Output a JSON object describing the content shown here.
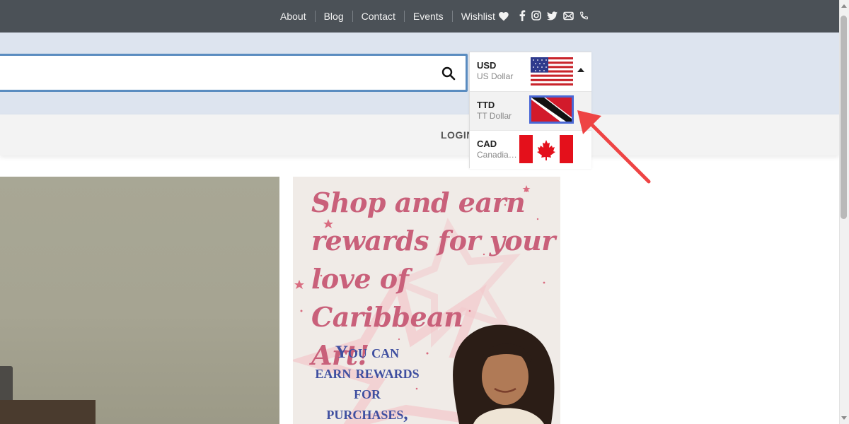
{
  "topnav": {
    "items": [
      {
        "label": "About"
      },
      {
        "label": "Blog"
      },
      {
        "label": "Contact"
      },
      {
        "label": "Events"
      },
      {
        "label": "Wishlist"
      }
    ]
  },
  "social_icons": [
    "facebook-icon",
    "instagram-icon",
    "twitter-icon",
    "email-icon",
    "phone-icon"
  ],
  "search": {
    "placeholder": "",
    "value": ""
  },
  "header": {
    "login_label": "LOGIN"
  },
  "currency": {
    "options": [
      {
        "code": "USD",
        "name": "US Dollar",
        "flag": "us-flag-icon",
        "selected": true
      },
      {
        "code": "TTD",
        "name": "TT Dollar",
        "flag": "tt-flag-icon",
        "highlighted": true
      },
      {
        "code": "CAD",
        "name": "Canadian Dollar",
        "flag": "ca-flag-icon"
      }
    ]
  },
  "promo": {
    "headline_lines": [
      "Shop and earn",
      "rewards for your",
      "love of Caribbean",
      "Art!"
    ],
    "sub_lines": [
      "You can",
      "earn rewards",
      "for",
      "purchases,"
    ]
  },
  "colors": {
    "topbar": "#4b5157",
    "search_band": "#dde4ef",
    "search_border": "#5a8cc0",
    "highlight_border": "#4a68d6",
    "arrow": "#ee4444",
    "promo_headline": "#c9607a",
    "promo_sub": "#3f4fa0"
  }
}
